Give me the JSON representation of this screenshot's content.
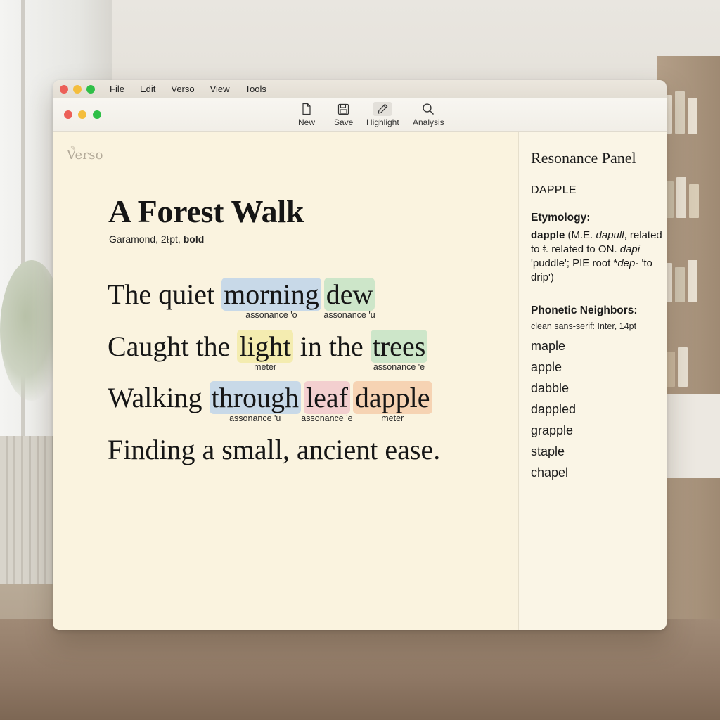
{
  "system_menu": {
    "items": [
      "File",
      "Edit",
      "Verso",
      "View",
      "Tools"
    ]
  },
  "colors": {
    "traffic_close": "#ec5f57",
    "traffic_minimize": "#f4bd3c",
    "traffic_zoom": "#2fbf47",
    "highlight_blue": "#c8d9e8",
    "highlight_green": "#cde6c9",
    "highlight_yellow": "#f4ecb0",
    "highlight_pink": "#f3cfcf",
    "highlight_orange": "#f6d3b3",
    "paper": "#faf3df"
  },
  "toolbar": {
    "new_label": "New",
    "save_label": "Save",
    "highlight_label": "Highlight",
    "analysis_label": "Analysis",
    "new_icon": "document-icon",
    "save_icon": "floppy-disk-icon",
    "highlight_icon": "pencil-icon",
    "analysis_icon": "magnifier-icon",
    "active_tool": "Highlight"
  },
  "editor": {
    "logo": "Verso",
    "title": "A Forest Walk",
    "font_info_prefix": "Garamond, 2",
    "font_info_glyph": "ℓ",
    "font_info_mid": "pt, ",
    "font_info_bold": "bold"
  },
  "poem": {
    "line1": {
      "before": "The quiet",
      "w1": "morning",
      "w1_tag": "assonance 'o",
      "w2": "dew",
      "w2_tag": "assonance 'u"
    },
    "line2": {
      "before": "Caught the",
      "w1": "light",
      "w1_tag": "meter",
      "mid": "in the",
      "w2": "trees",
      "w2_tag": "assonance 'e"
    },
    "line3": {
      "before": "Walking",
      "w1": "through",
      "w1_tag": "assonance 'u",
      "w2": "leaf",
      "w2_tag": "assonance 'e",
      "w3": "dapple",
      "w3_tag": "meter"
    },
    "line4": "Finding a small, ancient ease."
  },
  "panel": {
    "title": "Resonance Panel",
    "word": "DAPPLE",
    "etymology_heading": "Etymology:",
    "ety_word": "dapple",
    "ety_1": " (M.E. ",
    "ety_me": "dapull",
    "ety_2": ", related to ",
    "ety_glyph": "ᵮ",
    "ety_3": ". related to ON. ",
    "ety_on": "dapi",
    "ety_4": " 'puddle'; PIE root *",
    "ety_pie": "dep-",
    "ety_5": " 'to drip')",
    "neighbors_heading": "Phonetic Neighbors:",
    "neighbors_sub": "clean sans-serif: Inter, 14pt",
    "neighbors": [
      "maple",
      "apple",
      "dabble",
      "dappled",
      "grapple",
      "staple",
      "chapel"
    ]
  }
}
